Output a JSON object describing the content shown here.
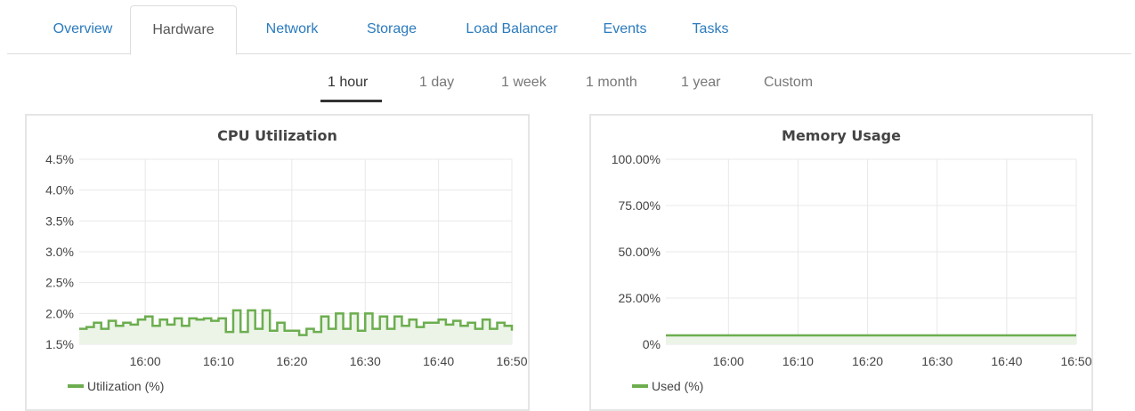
{
  "tabs": [
    {
      "label": "Overview",
      "active": false
    },
    {
      "label": "Hardware",
      "active": true
    },
    {
      "label": "Network",
      "active": false
    },
    {
      "label": "Storage",
      "active": false
    },
    {
      "label": "Load Balancer",
      "active": false
    },
    {
      "label": "Events",
      "active": false
    },
    {
      "label": "Tasks",
      "active": false
    }
  ],
  "time_ranges": [
    {
      "label": "1 hour",
      "active": true
    },
    {
      "label": "1 day",
      "active": false
    },
    {
      "label": "1 week",
      "active": false
    },
    {
      "label": "1 month",
      "active": false
    },
    {
      "label": "1 year",
      "active": false
    },
    {
      "label": "Custom",
      "active": false
    }
  ],
  "colors": {
    "link": "#2b7bbd",
    "series": "#6cae4f",
    "series_fill": "#ecf4e8",
    "grid": "#e8e8e8"
  },
  "chart_data": [
    {
      "type": "area",
      "title": "CPU Utilization",
      "xlabel": "",
      "ylabel": "",
      "x_ticks": [
        "16:00",
        "16:10",
        "16:20",
        "16:30",
        "16:40",
        "16:50"
      ],
      "x_range": [
        "15:51",
        "16:50"
      ],
      "y_ticks": [
        "1.5%",
        "2.0%",
        "2.5%",
        "3.0%",
        "3.5%",
        "4.0%",
        "4.5%"
      ],
      "ylim": [
        1.5,
        4.5
      ],
      "grid": true,
      "legend": "bottom-left",
      "series": [
        {
          "name": "Utilization (%)",
          "x": [
            "15:51",
            "15:52",
            "15:53",
            "15:54",
            "15:55",
            "15:56",
            "15:57",
            "15:58",
            "15:59",
            "16:00",
            "16:01",
            "16:02",
            "16:03",
            "16:04",
            "16:05",
            "16:06",
            "16:07",
            "16:08",
            "16:09",
            "16:10",
            "16:11",
            "16:12",
            "16:13",
            "16:14",
            "16:15",
            "16:16",
            "16:17",
            "16:18",
            "16:19",
            "16:20",
            "16:21",
            "16:22",
            "16:23",
            "16:24",
            "16:25",
            "16:26",
            "16:27",
            "16:28",
            "16:29",
            "16:30",
            "16:31",
            "16:32",
            "16:33",
            "16:34",
            "16:35",
            "16:36",
            "16:37",
            "16:38",
            "16:39",
            "16:40",
            "16:41",
            "16:42",
            "16:43",
            "16:44",
            "16:45",
            "16:46",
            "16:47",
            "16:48",
            "16:49",
            "16:50"
          ],
          "values": [
            1.75,
            1.78,
            1.85,
            1.75,
            1.88,
            1.8,
            1.85,
            1.82,
            1.9,
            1.95,
            1.8,
            1.9,
            1.82,
            1.92,
            1.8,
            1.92,
            1.9,
            1.92,
            1.88,
            1.92,
            1.7,
            2.05,
            1.7,
            2.05,
            1.75,
            2.05,
            1.72,
            1.85,
            1.72,
            1.72,
            1.65,
            1.75,
            1.7,
            1.95,
            1.75,
            2.0,
            1.75,
            2.0,
            1.72,
            2.0,
            1.75,
            1.95,
            1.75,
            1.95,
            1.8,
            1.9,
            1.78,
            1.85,
            1.85,
            1.9,
            1.82,
            1.88,
            1.8,
            1.85,
            1.75,
            1.9,
            1.75,
            1.85,
            1.8,
            1.72
          ]
        }
      ]
    },
    {
      "type": "area",
      "title": "Memory Usage",
      "xlabel": "",
      "ylabel": "",
      "x_ticks": [
        "16:00",
        "16:10",
        "16:20",
        "16:30",
        "16:40",
        "16:50"
      ],
      "x_range": [
        "15:51",
        "16:50"
      ],
      "y_ticks": [
        "0%",
        "25.00%",
        "50.00%",
        "75.00%",
        "100.00%"
      ],
      "ylim": [
        0,
        100
      ],
      "grid": true,
      "legend": "bottom-left",
      "series": [
        {
          "name": "Used (%)",
          "x": [
            "15:51",
            "16:50"
          ],
          "values": [
            4.8,
            4.8
          ]
        }
      ]
    }
  ]
}
